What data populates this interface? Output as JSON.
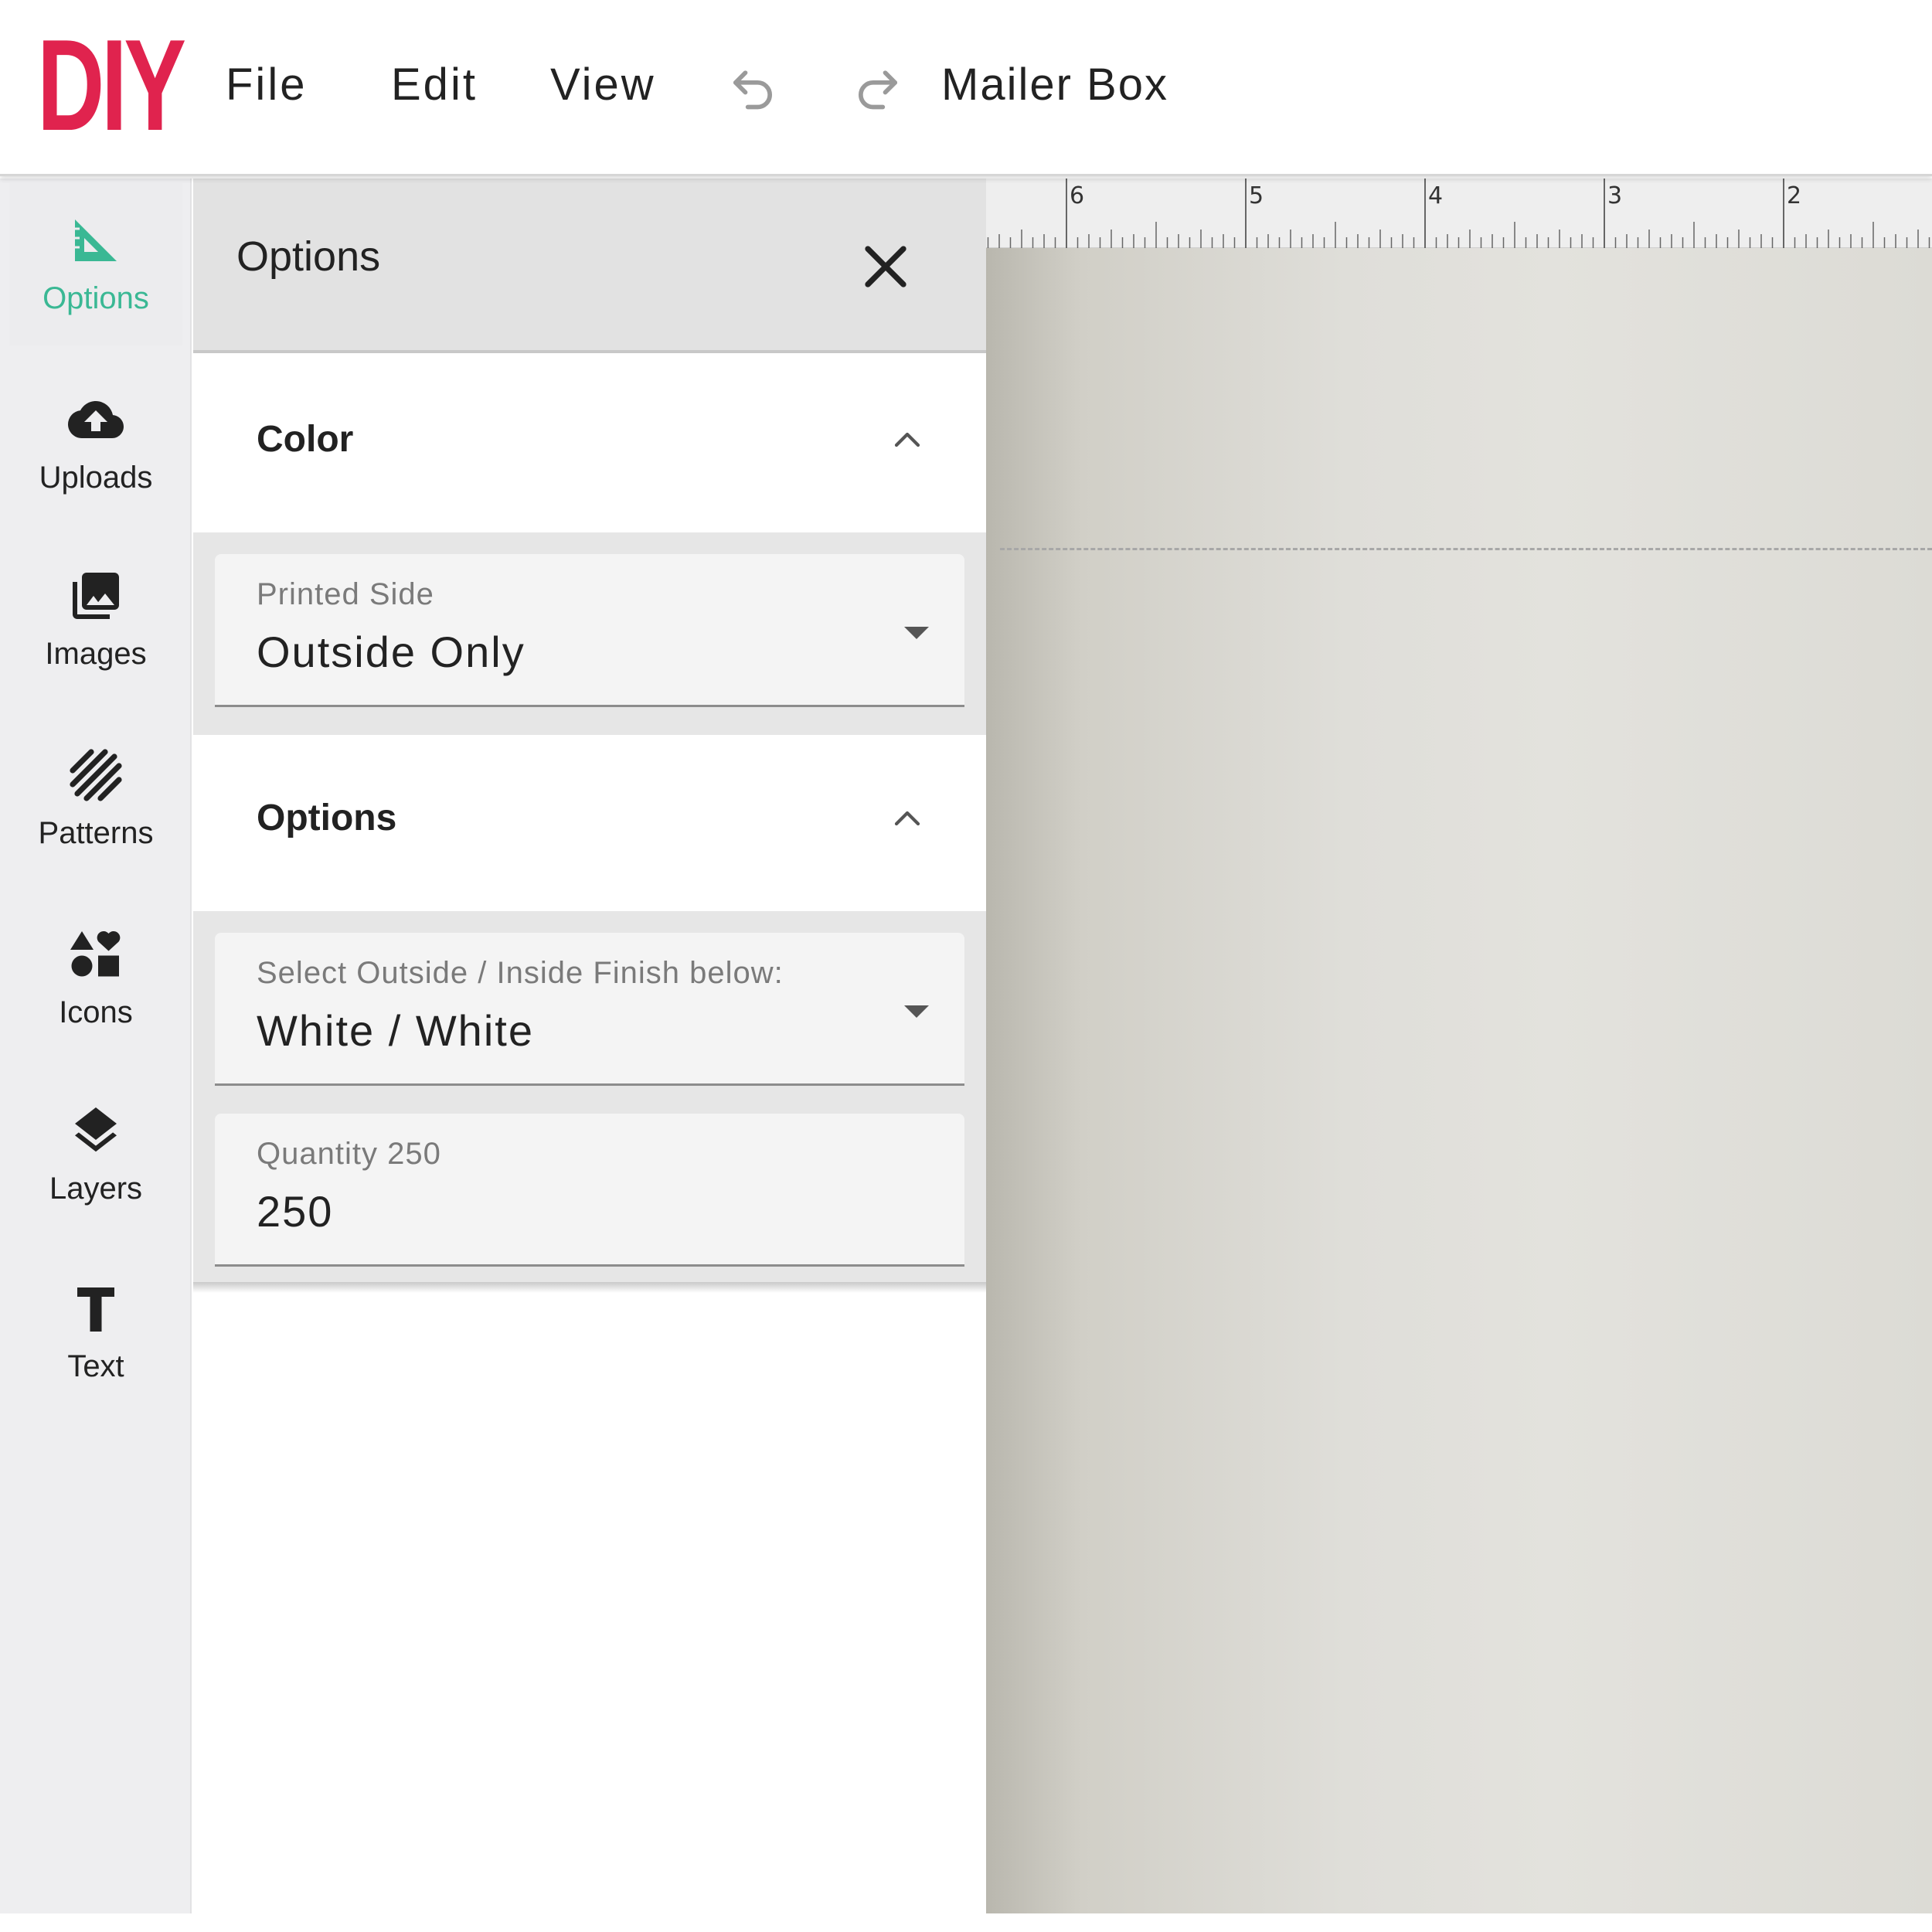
{
  "topbar": {
    "logo_text": "DIY",
    "menu": {
      "file": "File",
      "edit": "Edit",
      "view": "View"
    },
    "undo_icon": "undo-icon",
    "redo_icon": "redo-icon",
    "document_title": "Mailer Box",
    "brand_color": "#e0234e"
  },
  "rail": {
    "accent_color": "#3ab894",
    "items": [
      {
        "label": "Options",
        "icon": "set-square-icon",
        "active": true
      },
      {
        "label": "Uploads",
        "icon": "cloud-upload-icon",
        "active": false
      },
      {
        "label": "Images",
        "icon": "images-icon",
        "active": false
      },
      {
        "label": "Patterns",
        "icon": "patterns-icon",
        "active": false
      },
      {
        "label": "Icons",
        "icon": "shapes-icon",
        "active": false
      },
      {
        "label": "Layers",
        "icon": "layers-icon",
        "active": false
      },
      {
        "label": "Text",
        "icon": "text-icon",
        "active": false
      }
    ]
  },
  "panel": {
    "title": "Options",
    "close_icon": "close-icon",
    "sections": [
      {
        "title": "Color",
        "fields": [
          {
            "label": "Printed Side",
            "value": "Outside Only",
            "type": "select"
          }
        ]
      },
      {
        "title": "Options",
        "fields": [
          {
            "label": "Select Outside / Inside Finish below:",
            "value": "White / White",
            "type": "select"
          },
          {
            "label": "Quantity 250",
            "value": "250",
            "type": "input"
          }
        ]
      }
    ]
  },
  "ruler": {
    "labels": [
      "6",
      "5",
      "4",
      "3",
      "2"
    ]
  }
}
